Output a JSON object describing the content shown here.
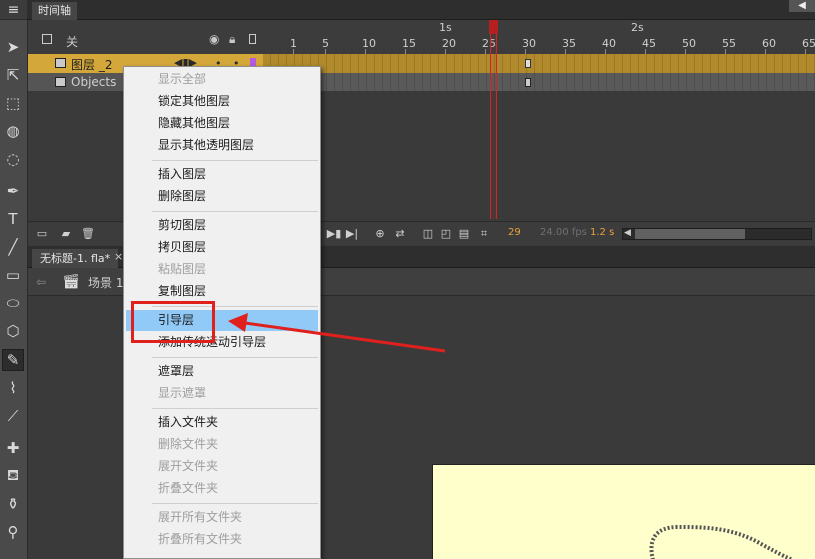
{
  "timeline": {
    "tab_title": "时间轴",
    "layer_header_label": "关",
    "ruler_seconds": [
      "1s",
      "2s"
    ],
    "ruler_frames": [
      "1",
      "5",
      "10",
      "15",
      "20",
      "25",
      "30",
      "35",
      "40",
      "45",
      "50",
      "55",
      "60",
      "65"
    ],
    "layers": [
      {
        "name": "图层 _2",
        "selected": true
      },
      {
        "name": "Objects",
        "selected": false
      }
    ],
    "footer": {
      "current_frame": "29",
      "fps": "24.00 fps",
      "time": "1.2 s"
    }
  },
  "document": {
    "tab_title": "无标题-1. fla*",
    "close_glyph": "×",
    "scene_label": "场景 1"
  },
  "context_menu": {
    "items": [
      {
        "label": "显示全部",
        "disabled": true
      },
      {
        "label": "锁定其他图层",
        "disabled": false
      },
      {
        "label": "隐藏其他图层",
        "disabled": false
      },
      {
        "label": "显示其他透明图层",
        "disabled": false
      },
      {
        "label": "插入图层",
        "disabled": false
      },
      {
        "label": "删除图层",
        "disabled": false
      },
      {
        "label": "剪切图层",
        "disabled": false
      },
      {
        "label": "拷贝图层",
        "disabled": false
      },
      {
        "label": "粘贴图层",
        "disabled": true
      },
      {
        "label": "复制图层",
        "disabled": false
      },
      {
        "label": "引导层",
        "disabled": false,
        "highlighted": true
      },
      {
        "label": "添加传统运动引导层",
        "disabled": false
      },
      {
        "label": "遮罩层",
        "disabled": false
      },
      {
        "label": "显示遮罩",
        "disabled": true
      },
      {
        "label": "插入文件夹",
        "disabled": false
      },
      {
        "label": "删除文件夹",
        "disabled": true
      },
      {
        "label": "展开文件夹",
        "disabled": true
      },
      {
        "label": "折叠文件夹",
        "disabled": true
      },
      {
        "label": "展开所有文件夹",
        "disabled": true
      },
      {
        "label": "折叠所有文件夹",
        "disabled": true
      }
    ]
  },
  "colors": {
    "highlight": "#91c9f7",
    "annotation": "#e0201c",
    "selected_layer": "#d4a73a",
    "playhead": "#cf2727",
    "stage": "#ffffcc",
    "frame_counter": "#e8a23a"
  },
  "icons": [
    "selection-tool-icon",
    "subselection-tool-icon",
    "free-transform-icon",
    "3d-rotation-icon",
    "lasso-icon",
    "pen-icon",
    "text-icon",
    "line-icon",
    "rectangle-icon",
    "oval-icon",
    "polystar-icon",
    "pencil-icon",
    "brush-icon",
    "paint-brush-icon",
    "bone-icon",
    "paint-bucket-icon",
    "ink-bottle-icon",
    "eyedropper-icon"
  ]
}
